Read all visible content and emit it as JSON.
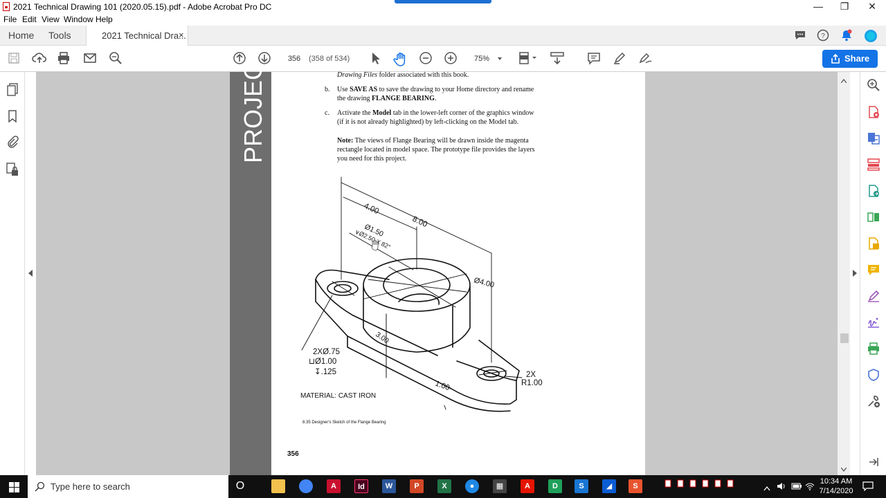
{
  "window": {
    "title": "2021 Technical Drawing 101 (2020.05.15).pdf - Adobe Acrobat Pro DC",
    "minimize": "—",
    "restore": "❐",
    "close": "✕"
  },
  "menu": [
    "File",
    "Edit",
    "View",
    "Window",
    "Help"
  ],
  "tabs": {
    "home": "Home",
    "tools": "Tools",
    "document": "2021 Technical Dra...",
    "close": "×"
  },
  "toolbar": {
    "page_number": "356",
    "page_count": "(358 of 534)",
    "zoom": "75%",
    "share_label": "Share"
  },
  "document": {
    "side_heading": "PROJEC",
    "line_top": "folder associated with this book.",
    "line_top_italic": "Drawing Files",
    "item_b_marker": "b.",
    "item_b_text_1": "to save the drawing to your Home directory and rename",
    "item_b_use": "Use",
    "item_b_save_as": "SAVE AS",
    "item_b_text_2": "the drawing",
    "item_b_name": "FLANGE BEARING",
    "item_c_marker": "c.",
    "item_c_activate": "Activate the",
    "item_c_model": "Model",
    "item_c_text_1": "tab in the lower-left corner of the graphics window",
    "item_c_text_2": "(if it is not already highlighted) by left-clicking on the Model tab.",
    "note_label": "Note:",
    "note_text_1": "The views of Flange Bearing will be drawn inside the magenta",
    "note_text_2": "rectangle located in model space. The prototype file provides the layers",
    "note_text_3": "you need for this project.",
    "figure": {
      "dim_4": "4.00",
      "dim_8": "8.00",
      "dia_150": "Ø1.50",
      "cbore": "∨Ø2.50 X 82°",
      "dia_400": "Ø4.00",
      "dim_300": "3.00",
      "holes_1": "2XØ.75",
      "holes_2": "⊔Ø1.00",
      "holes_3": "↧.125",
      "dim_100": "1.00",
      "radius_1": "2X",
      "radius_2": "R1.00",
      "material": "MATERIAL: CAST IRON",
      "caption": "8.35 Designer's Sketch of the Flange Bearing"
    },
    "page_footer": "356"
  },
  "taskbar": {
    "search_placeholder": "Type here to search",
    "time": "10:34 AM",
    "date": "7/14/2020",
    "apps": [
      {
        "name": "cortana-icon",
        "glyph": "O",
        "color": "#101010"
      },
      {
        "name": "file-explorer-icon",
        "glyph": "",
        "color": "#f2c14e"
      },
      {
        "name": "chrome-icon",
        "glyph": "",
        "color": "#4285f4"
      },
      {
        "name": "acrobat-icon",
        "glyph": "A",
        "color": "#c8102e"
      },
      {
        "name": "indesign-icon",
        "glyph": "Id",
        "color": "#49021f"
      },
      {
        "name": "word-icon",
        "glyph": "W",
        "color": "#2b579a"
      },
      {
        "name": "powerpoint-icon",
        "glyph": "P",
        "color": "#d24726"
      },
      {
        "name": "excel-icon",
        "glyph": "X",
        "color": "#217346"
      },
      {
        "name": "app-blue-circle-icon",
        "glyph": "●",
        "color": "#1e88e5"
      },
      {
        "name": "calculator-icon",
        "glyph": "▦",
        "color": "#444444"
      },
      {
        "name": "autocad-icon",
        "glyph": "A",
        "color": "#e51400"
      },
      {
        "name": "app-green-d-icon",
        "glyph": "D",
        "color": "#1fa05a"
      },
      {
        "name": "app-s-blue-icon",
        "glyph": "S",
        "color": "#1976d2"
      },
      {
        "name": "app-blue-icon",
        "glyph": "◢",
        "color": "#0b5cd5"
      },
      {
        "name": "app-s-orange-icon",
        "glyph": "S",
        "color": "#e8542e"
      }
    ]
  },
  "colors": {
    "accent": "#1473e6",
    "pdf_red": "#c8102e"
  }
}
